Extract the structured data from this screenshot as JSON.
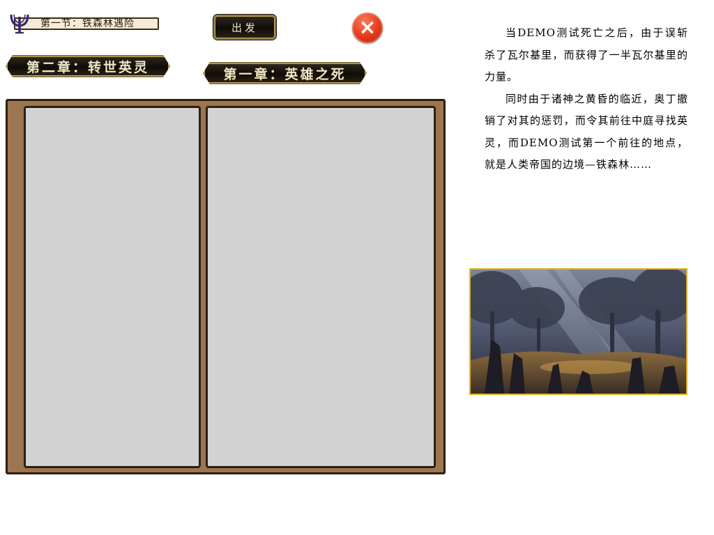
{
  "section": {
    "title": "第一节：铁森林遇险"
  },
  "buttons": {
    "go_label": "出发",
    "close_icon": "×"
  },
  "chapters": {
    "current": "第二章：转世英灵",
    "previous": "第一章：英雄之死"
  },
  "story": {
    "paragraphs": [
      "当DEMO测试死亡之后，由于误斩杀了瓦尔基里，而获得了一半瓦尔基里的力量。",
      "同时由于诸神之黄昏的临近，奥丁撤销了对其的惩罚，而令其前往中庭寻找英灵，而DEMO测试第一个前往的地点，就是人类帝国的边境—铁森林……"
    ]
  },
  "colors": {
    "book_frame": "#9c7651",
    "page_fill": "#d3d3d3",
    "close_red": "#e03a1a",
    "image_border": "#e0b226",
    "gold_trim": "#8b7540"
  },
  "icons": [
    "emblem-icon",
    "close-icon",
    "forest-image"
  ]
}
